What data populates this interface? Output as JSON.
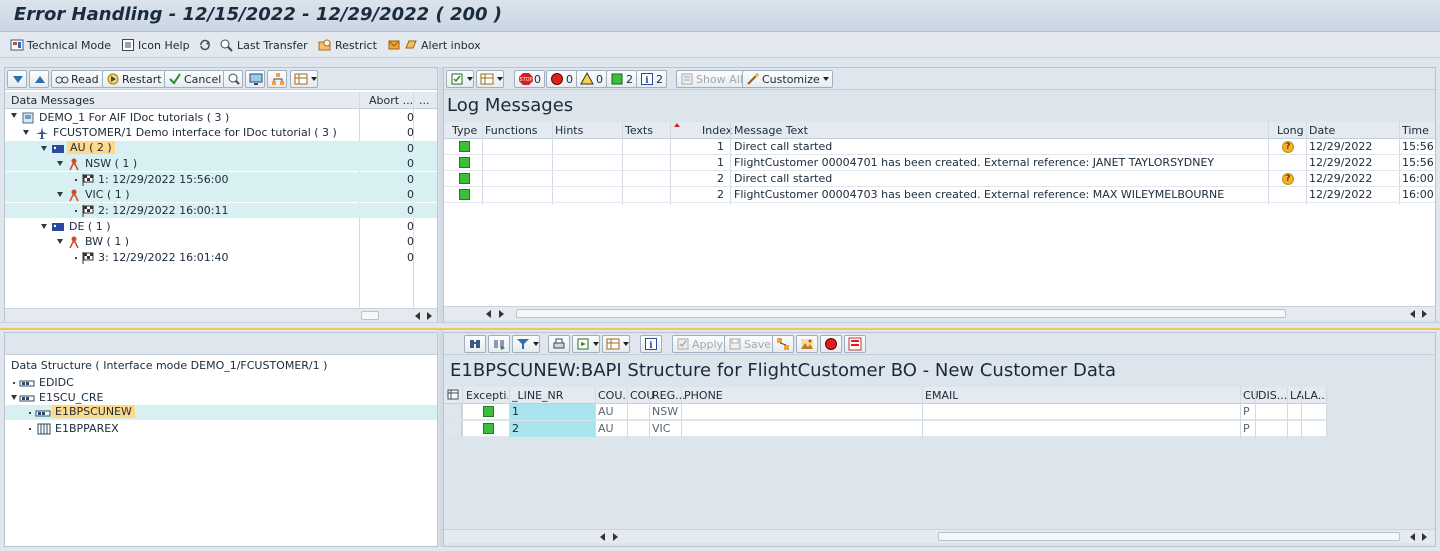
{
  "window": {
    "title": "Error Handling - 12/15/2022 - 12/29/2022 ( 200 )"
  },
  "app_toolbar": {
    "technical_mode": "Technical Mode",
    "icon_help": "Icon Help",
    "last_transfer": "Last Transfer",
    "restrict": "Restrict",
    "alert_inbox": "Alert inbox"
  },
  "messages_toolbar": {
    "read": "Read",
    "restart": "Restart",
    "cancel": "Cancel"
  },
  "messages_tree": {
    "col_data_messages": "Data Messages",
    "col_abort": "Abort ...",
    "col_more": "...",
    "rows": [
      {
        "label": "DEMO_1 For AIF IDoc tutorials ( 3 )",
        "abort": "0"
      },
      {
        "label": "FCUSTOMER/1 Demo interface for IDoc tutorial ( 3 )",
        "abort": "0"
      },
      {
        "label": "AU ( 2 )",
        "abort": "0"
      },
      {
        "label": "NSW ( 1 )",
        "abort": "0"
      },
      {
        "label": "1: 12/29/2022 15:56:00",
        "abort": "0"
      },
      {
        "label": "VIC ( 1 )",
        "abort": "0"
      },
      {
        "label": "2: 12/29/2022 16:00:11",
        "abort": "0"
      },
      {
        "label": "DE ( 1 )",
        "abort": "0"
      },
      {
        "label": "BW ( 1 )",
        "abort": "0"
      },
      {
        "label": "3: 12/29/2022 16:01:40",
        "abort": "0"
      }
    ]
  },
  "log_toolbar": {
    "count_error_stop": "0",
    "count_error": "0",
    "count_warning": "0",
    "count_success": "2",
    "count_info": "2",
    "show_all": "Show All",
    "customize": "Customize"
  },
  "log": {
    "title": "Log Messages",
    "columns": {
      "type": "Type",
      "functions": "Functions",
      "hints": "Hints",
      "texts": "Texts",
      "index": "Index",
      "message": "Message Text",
      "long": "Long",
      "date": "Date",
      "time": "Time"
    },
    "rows": [
      {
        "index": "1",
        "message": "Direct call started",
        "long": "?",
        "date": "12/29/2022",
        "time": "15:56"
      },
      {
        "index": "1",
        "message": "FlightCustomer 00004701 has been created. External reference: JANET TAYLORSYDNEY",
        "long": "",
        "date": "12/29/2022",
        "time": "15:56"
      },
      {
        "index": "2",
        "message": "Direct call started",
        "long": "?",
        "date": "12/29/2022",
        "time": "16:00"
      },
      {
        "index": "2",
        "message": "FlightCustomer 00004703 has been created. External reference: MAX WILEYMELBOURNE",
        "long": "",
        "date": "12/29/2022",
        "time": "16:00"
      }
    ]
  },
  "structure_tree": {
    "header": "Data Structure ( Interface mode DEMO_1/FCUSTOMER/1 )",
    "rows": [
      {
        "label": "EDIDC"
      },
      {
        "label": "E1SCU_CRE"
      },
      {
        "label": "E1BPSCUNEW"
      },
      {
        "label": "E1BPPAREX"
      }
    ]
  },
  "detail_toolbar": {
    "apply": "Apply",
    "save": "Save"
  },
  "detail": {
    "title": "E1BPSCUNEW:BAPI Structure for FlightCustomer BO - New Customer Data",
    "columns": {
      "exception": "Excepti...",
      "line_nr": "_LINE_NR",
      "cou1": "COU...",
      "cou2": "COU",
      "region": "REG...",
      "phone": "PHONE",
      "email": "EMAIL",
      "cu": "CU",
      "dis": "DIS...",
      "la1": "LA",
      "la2": "LA..."
    },
    "rows": [
      {
        "line_nr": "1",
        "cou1": "AU",
        "cou2": "",
        "region": "NSW",
        "phone": "",
        "email": "",
        "cu": "P",
        "dis": "",
        "la1": "",
        "la2": ""
      },
      {
        "line_nr": "2",
        "cou1": "AU",
        "cou2": "",
        "region": "VIC",
        "phone": "",
        "email": "",
        "cu": "P",
        "dis": "",
        "la1": "",
        "la2": ""
      }
    ]
  },
  "colors": {
    "selected_row": "#d9f0f3",
    "highlight_node": "#ffd98a",
    "success_green": "#3bbf3b",
    "warning_orange": "#f0b429"
  }
}
